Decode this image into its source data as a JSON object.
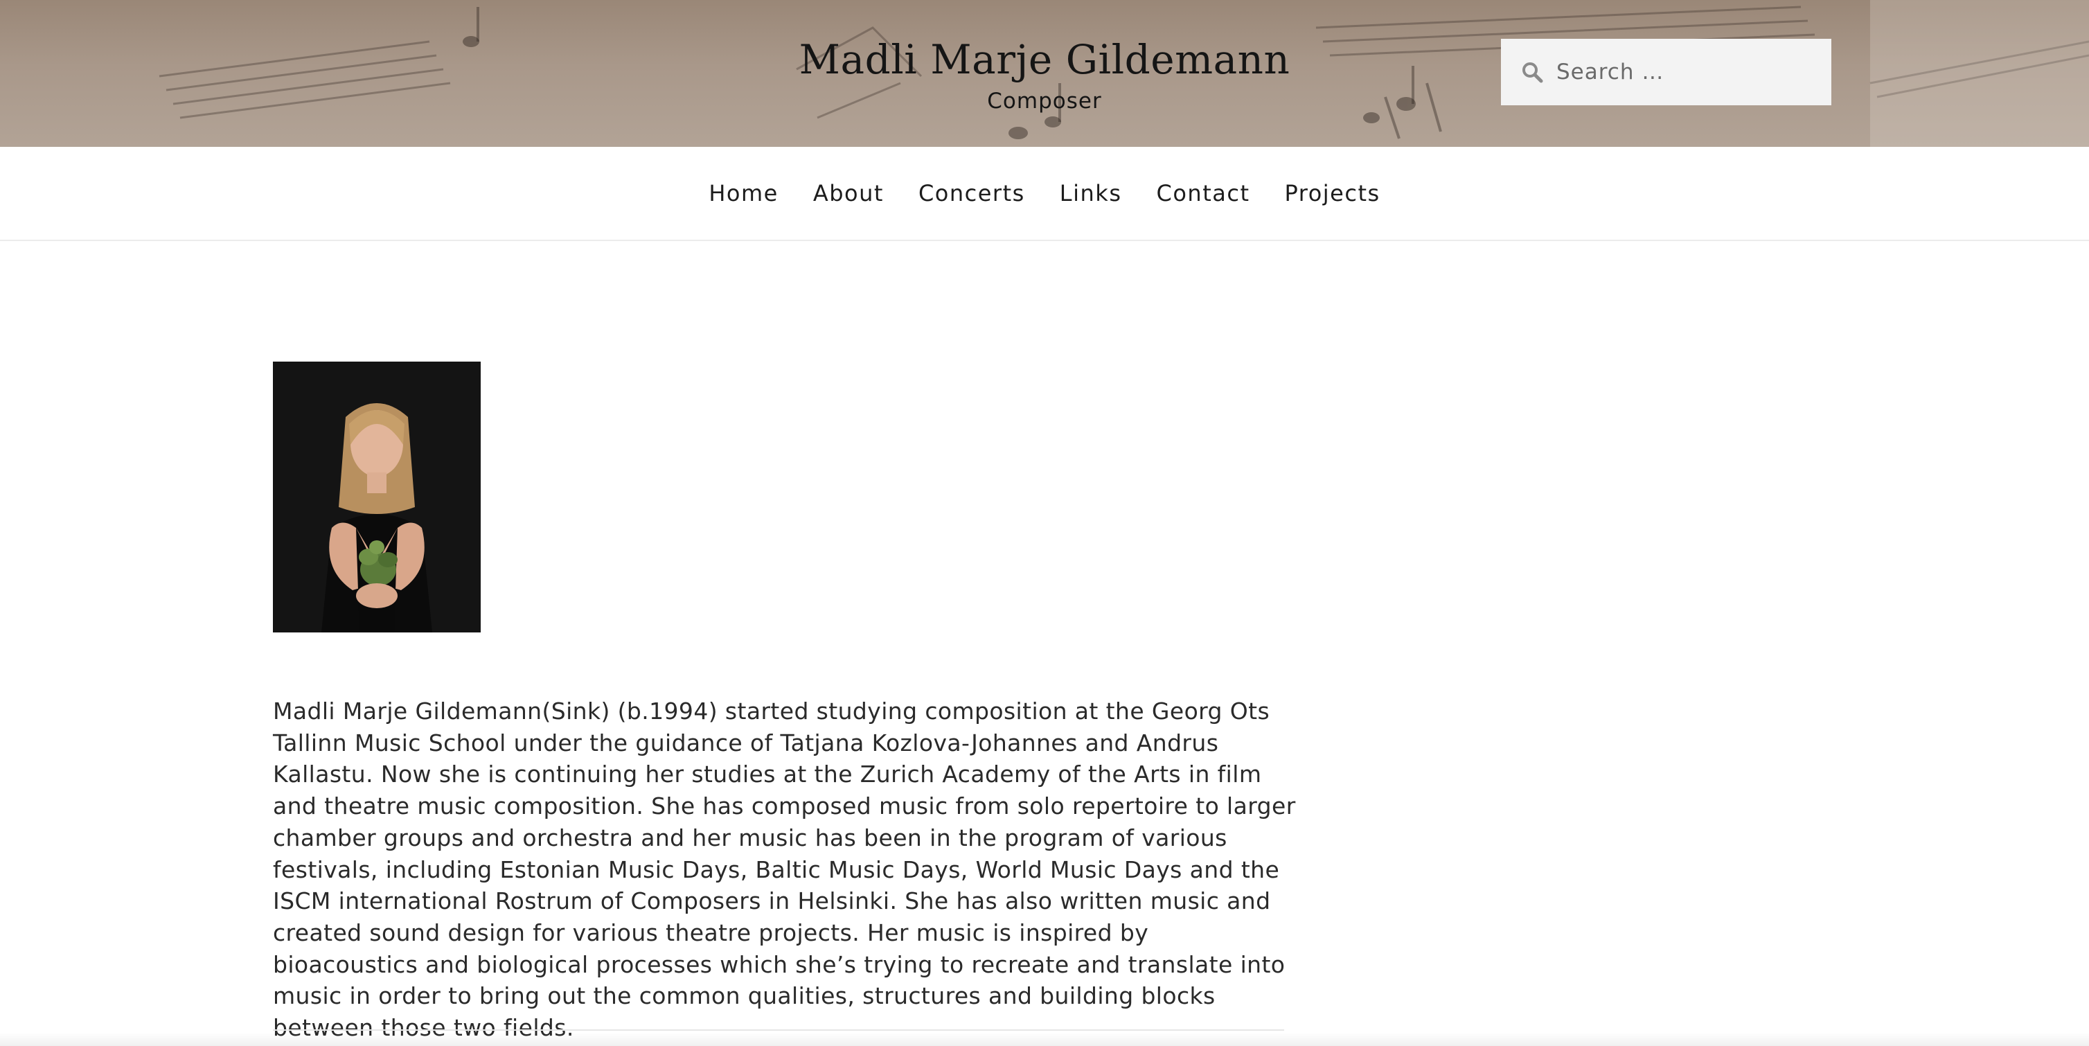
{
  "header": {
    "site_title": "Madli Marje Gildemann",
    "tagline": "Composer",
    "background_color": "#a69484"
  },
  "search": {
    "placeholder": "Search …",
    "value": "",
    "icon": "search-icon"
  },
  "nav": {
    "items": [
      {
        "label": "Home"
      },
      {
        "label": "About"
      },
      {
        "label": "Concerts"
      },
      {
        "label": "Links"
      },
      {
        "label": "Contact"
      },
      {
        "label": "Projects"
      }
    ]
  },
  "content": {
    "bio": "Madli Marje Gildemann(Sink) (b.1994) started studying composition at the Georg Ots Tallinn Music School under the guidance of Tatjana Kozlova-Johannes and Andrus Kallastu. Now she is continuing her studies at the Zurich Academy of the Arts in film and theatre music composition. She has composed music from solo repertoire to larger chamber groups and orchestra and her music has been in the program of various festivals, including Estonian Music Days, Baltic Music Days, World Music Days and the ISCM international Rostrum of Composers in Helsinki. She has also written music and created sound design for various theatre projects. Her music is inspired by bioacoustics and biological processes which she’s trying to recreate and translate into music in order to bring out the common qualities, structures and building blocks between those two fields."
  }
}
